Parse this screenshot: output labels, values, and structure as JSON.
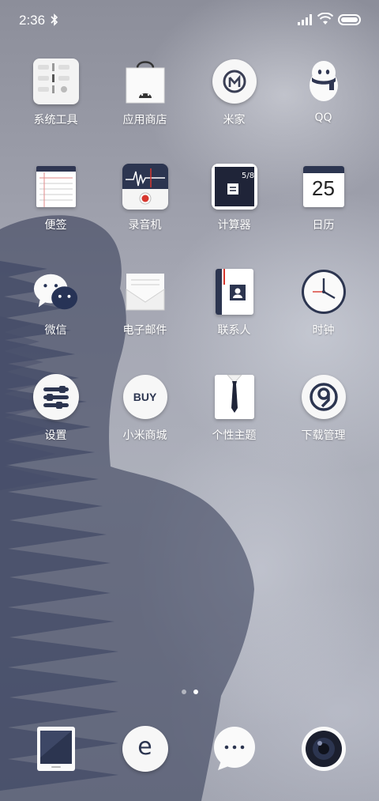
{
  "status_bar": {
    "time": "2:36",
    "icons": [
      "bluetooth-icon",
      "signal-icon",
      "wifi-icon",
      "battery-icon"
    ],
    "battery_level": 1.0
  },
  "apps": [
    {
      "label": "系统工具",
      "icon": "system-tools-folder-icon"
    },
    {
      "label": "应用商店",
      "icon": "app-store-bag-icon"
    },
    {
      "label": "米家",
      "icon": "mijia-icon"
    },
    {
      "label": "QQ",
      "icon": "qq-penguin-icon"
    },
    {
      "label": "便签",
      "icon": "notes-icon"
    },
    {
      "label": "录音机",
      "icon": "recorder-icon"
    },
    {
      "label": "计算器",
      "icon": "calculator-icon"
    },
    {
      "label": "日历",
      "icon": "calendar-icon",
      "badge": "25"
    },
    {
      "label": "微信",
      "icon": "wechat-icon"
    },
    {
      "label": "电子邮件",
      "icon": "email-envelope-icon"
    },
    {
      "label": "联系人",
      "icon": "contacts-book-icon"
    },
    {
      "label": "时钟",
      "icon": "clock-icon"
    },
    {
      "label": "设置",
      "icon": "settings-icon"
    },
    {
      "label": "小米商城",
      "icon": "mi-store-icon",
      "badge": "BUY"
    },
    {
      "label": "个性主题",
      "icon": "themes-shirt-icon"
    },
    {
      "label": "下载管理",
      "icon": "download-manager-icon"
    }
  ],
  "page_indicator": {
    "pages": 2,
    "active": 2
  },
  "dock": [
    {
      "icon": "phone-icon"
    },
    {
      "icon": "browser-icon",
      "glyph": "e"
    },
    {
      "icon": "messages-icon",
      "glyph": "···"
    },
    {
      "icon": "camera-icon"
    }
  ],
  "colors": {
    "accent_red": "#d7372f",
    "dark_navy": "#2c3550",
    "wechat_navy": "#273356"
  }
}
